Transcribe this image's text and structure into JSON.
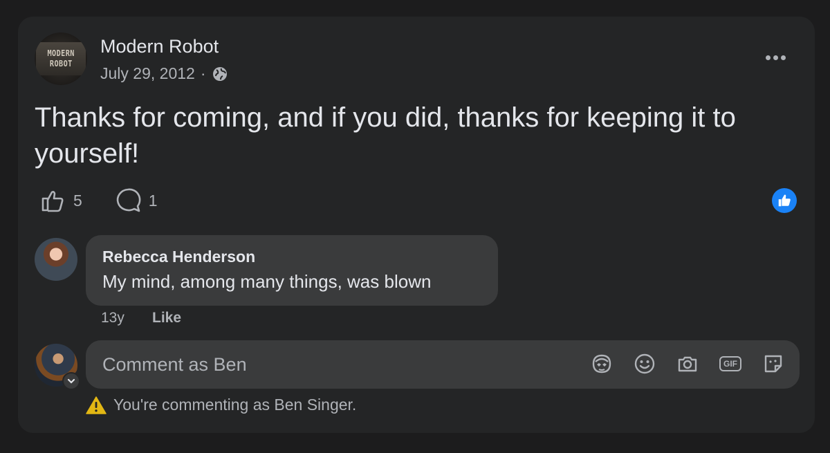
{
  "post": {
    "page_name": "Modern Robot",
    "avatar_text_line1": "MODERN",
    "avatar_text_line2": "ROBOT",
    "date": "July 29, 2012",
    "separator": "·",
    "audience_icon": "globe-icon",
    "text": "Thanks for coming, and if you did, thanks for keeping it to yourself!",
    "likes": "5",
    "comments": "1"
  },
  "comment": {
    "author": "Rebecca Henderson",
    "text": "My mind, among many things, was blown",
    "time": "13y",
    "like_label": "Like"
  },
  "composer": {
    "placeholder": "Comment as Ben",
    "notice": "You're commenting as Ben Singer.",
    "tools": [
      "avatar-sticker-icon",
      "emoji-icon",
      "camera-icon",
      "gif-icon",
      "sticker-icon"
    ],
    "gif_label": "GIF"
  },
  "colors": {
    "accent": "#1a82f6",
    "warning": "#e2b714"
  }
}
